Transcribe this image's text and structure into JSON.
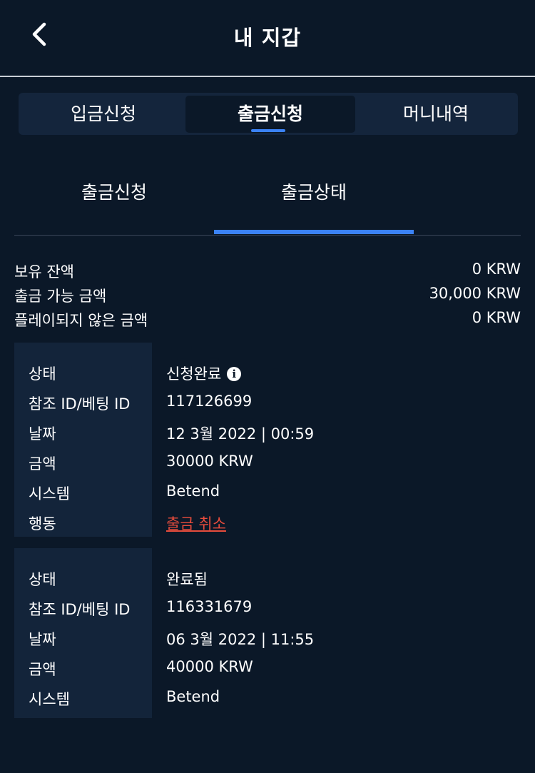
{
  "header": {
    "title": "내 지갑"
  },
  "main_tabs": [
    {
      "label": "입금신청"
    },
    {
      "label": "출금신청"
    },
    {
      "label": "머니내역"
    }
  ],
  "sub_tabs": [
    {
      "label": "출금신청"
    },
    {
      "label": "출금상태"
    }
  ],
  "balance": {
    "held_label": "보유 잔액",
    "held_value": "0 KRW",
    "withdrawable_label": "출금 가능 금액",
    "withdrawable_value": "30,000 KRW",
    "unplayed_label": "플레이되지 않은 금액",
    "unplayed_value": "0 KRW"
  },
  "labels": {
    "status": "상태",
    "ref_id": "참조 ID/베팅 ID",
    "date": "날짜",
    "amount": "금액",
    "system": "시스템",
    "action": "행동"
  },
  "records": [
    {
      "status": "신청완료",
      "ref_id": "117126699",
      "date": "12 3월 2022 | 00:59",
      "amount": "30000 KRW",
      "system": "Betend",
      "action": "출금 취소"
    },
    {
      "status": "완료됨",
      "ref_id": "116331679",
      "date": "06 3월 2022 | 11:55",
      "amount": "40000 KRW",
      "system": "Betend"
    }
  ],
  "icons": {
    "back": "chevron-left-icon",
    "info": "info-icon"
  },
  "colors": {
    "background": "#0b1828",
    "accent": "#3b82f6",
    "cancel": "#e74c3c",
    "panel": "#14253c"
  }
}
